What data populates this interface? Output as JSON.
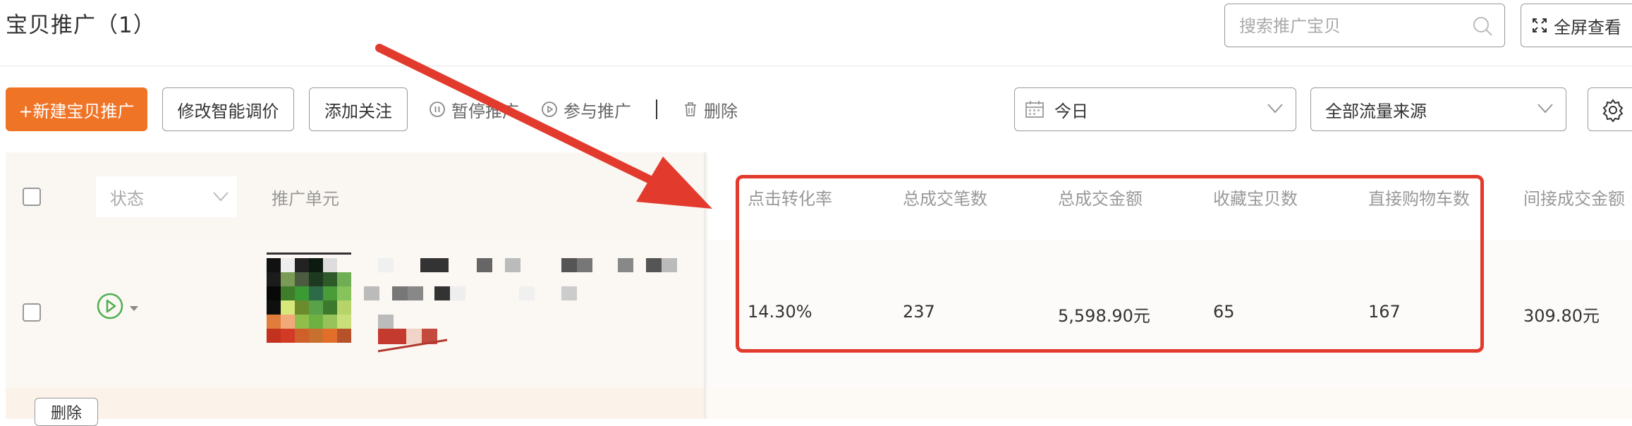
{
  "header": {
    "title": "宝贝推广（1）",
    "search_placeholder": "搜索推广宝贝",
    "fullscreen_label": "全屏查看"
  },
  "toolbar": {
    "new_label": "+新建宝贝推广",
    "smart_bid_label": "修改智能调价",
    "follow_label": "添加关注",
    "pause_label": "暂停推广",
    "join_label": "参与推广",
    "delete_label": "删除",
    "date_value": "今日",
    "flow_value": "全部流量来源"
  },
  "table": {
    "status_placeholder": "状态",
    "unit_header": "推广单元",
    "columns": [
      "点击转化率",
      "总成交笔数",
      "总成交金额",
      "收藏宝贝数",
      "直接购物车数",
      "间接成交金额"
    ],
    "rows": [
      {
        "values": [
          "14.30%",
          "237",
          "5,598.90元",
          "65",
          "167",
          "309.80元"
        ]
      }
    ],
    "footer_delete_label": "删除"
  },
  "colors": {
    "primary": "#f07426",
    "highlight": "#e23b2d",
    "play": "#4caf50"
  },
  "icons": [
    "search-icon",
    "fullscreen-icon",
    "pause-icon",
    "play-icon",
    "trash-icon",
    "calendar-icon",
    "chevron-down-icon",
    "gear-icon",
    "status-play-icon"
  ]
}
